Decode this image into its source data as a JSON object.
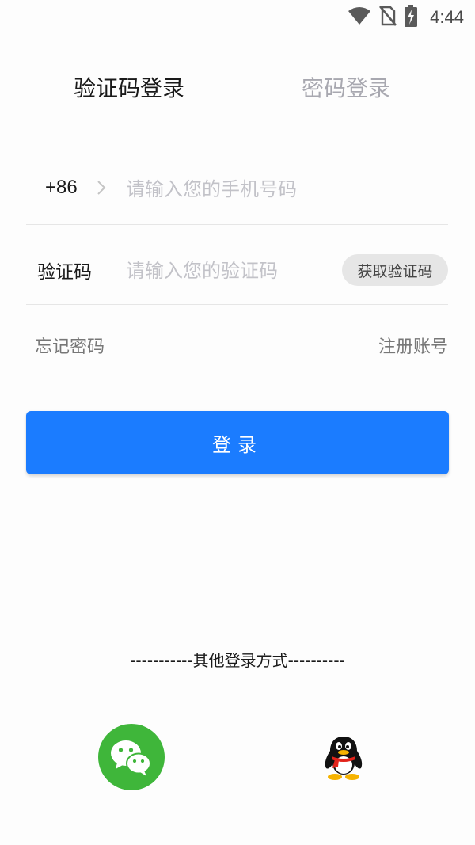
{
  "status_bar": {
    "time": "4:44",
    "icons": [
      "wifi-icon",
      "no-sim-icon",
      "battery-charging-icon"
    ]
  },
  "tabs": [
    {
      "label": "验证码登录",
      "active": true
    },
    {
      "label": "密码登录",
      "active": false
    }
  ],
  "phone_row": {
    "country_code": "+86",
    "placeholder": "请输入您的手机号码",
    "value": ""
  },
  "code_row": {
    "label": "验证码",
    "placeholder": "请输入您的验证码",
    "value": "",
    "get_code_label": "获取验证码"
  },
  "links": {
    "forgot": "忘记密码",
    "register": "注册账号"
  },
  "login_button": "登录",
  "other_login": {
    "title": "-----------其他登录方式----------",
    "providers": [
      "wechat-icon",
      "qq-icon"
    ]
  },
  "colors": {
    "primary": "#1b7cff",
    "wechat": "#3fb63a",
    "placeholder": "#c2c2c8",
    "inactive_tab": "#a8a8b0"
  }
}
